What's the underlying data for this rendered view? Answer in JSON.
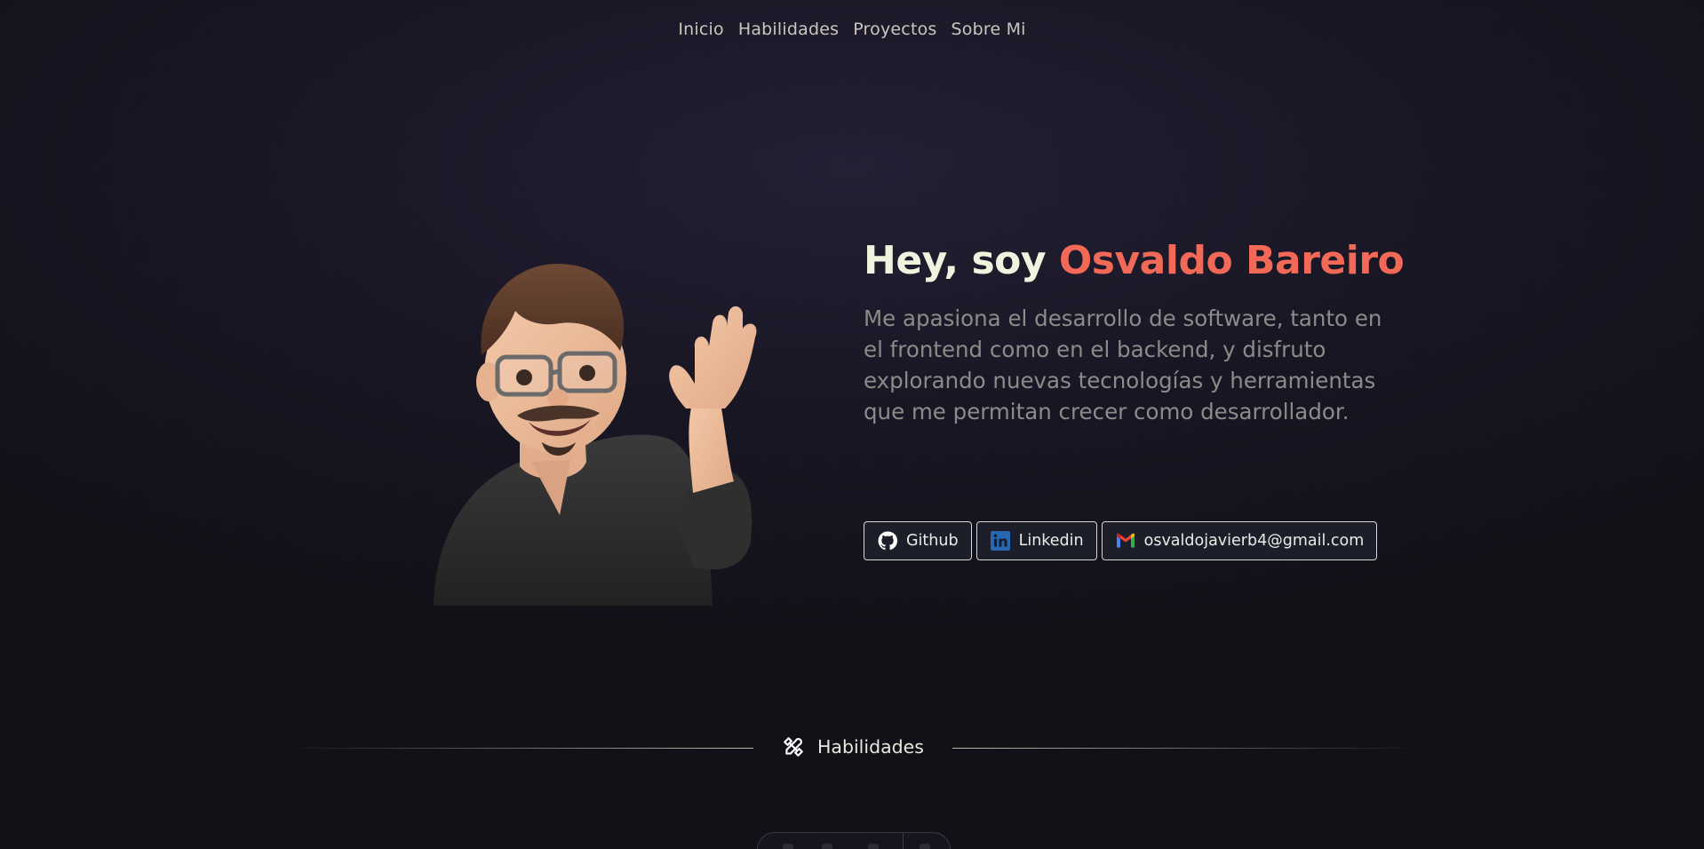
{
  "nav": {
    "items": [
      {
        "label": "Inicio"
      },
      {
        "label": "Habilidades"
      },
      {
        "label": "Proyectos"
      },
      {
        "label": "Sobre Mi"
      }
    ]
  },
  "hero": {
    "greeting": "Hey, soy",
    "name": "Osvaldo Bareiro",
    "description": "Me apasiona el desarrollo de software, tanto en el frontend como en el backend, y disfruto explorando nuevas tecnologías y herramientas que me permitan crecer como desarrollador."
  },
  "socials": {
    "github": {
      "label": "Github",
      "icon": "github-icon"
    },
    "linkedin": {
      "label": "Linkedin",
      "icon": "linkedin-icon"
    },
    "email": {
      "label": "osvaldojavierb4@gmail.com",
      "icon": "gmail-icon"
    }
  },
  "skills_section": {
    "title": "Habilidades",
    "icon": "tools-icon"
  },
  "colors": {
    "accent": "#f26a57",
    "title": "#f2f3df",
    "muted_text": "#8d8b8a",
    "background": "#1a1726"
  }
}
